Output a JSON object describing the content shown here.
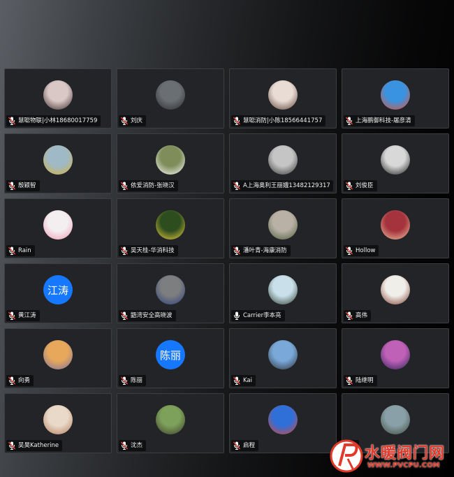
{
  "participants": [
    {
      "name": "慧聪物联|小林18680017759",
      "mic": "muted",
      "avatar": {
        "type": "photo",
        "colors": [
          "#d9c8c6",
          "#3a2a28"
        ]
      }
    },
    {
      "name": "刘庆",
      "mic": "muted",
      "avatar": {
        "type": "photo",
        "colors": [
          "#6a6f74",
          "#2c2c2c"
        ]
      }
    },
    {
      "name": "慧聪消防|小陈18566441757",
      "mic": "muted",
      "avatar": {
        "type": "photo",
        "colors": [
          "#e8dcd5",
          "#5a3e33"
        ]
      }
    },
    {
      "name": "上海鹏御科技-屠彦清",
      "mic": "muted",
      "avatar": {
        "type": "photo",
        "colors": [
          "#3a93e0",
          "#e45234"
        ]
      }
    },
    {
      "name": "殷颖智",
      "mic": "muted",
      "avatar": {
        "type": "photo",
        "colors": [
          "#9fb9c6",
          "#d6b23b"
        ]
      }
    },
    {
      "name": "依爱消防-张晓汉",
      "mic": "muted",
      "avatar": {
        "type": "photo",
        "colors": [
          "#7e8d5a",
          "#ffffff"
        ]
      }
    },
    {
      "name": "A上海奥利王丽娥13482129317",
      "mic": "muted",
      "avatar": {
        "type": "photo",
        "colors": [
          "#c5c5c5",
          "#333333"
        ]
      }
    },
    {
      "name": "刘俊臣",
      "mic": "muted",
      "avatar": {
        "type": "photo",
        "colors": [
          "#d8d8d8",
          "#1a1a1a"
        ]
      }
    },
    {
      "name": "Rain",
      "mic": "muted",
      "avatar": {
        "type": "photo",
        "colors": [
          "#f3eef0",
          "#f19ab2"
        ]
      }
    },
    {
      "name": "吴天桂-华消科技",
      "mic": "muted",
      "avatar": {
        "type": "photo",
        "colors": [
          "#2e4d1f",
          "#f2d23c"
        ]
      }
    },
    {
      "name": "潘叶青-海康消防",
      "mic": "muted",
      "avatar": {
        "type": "photo",
        "colors": [
          "#b9b1a6",
          "#4b5c3a"
        ]
      }
    },
    {
      "name": "Hollow",
      "mic": "muted",
      "avatar": {
        "type": "photo",
        "colors": [
          "#a5333d",
          "#f2c7a3"
        ]
      }
    },
    {
      "name": "黄江涛",
      "mic": "muted",
      "avatar": {
        "type": "text",
        "text": "江涛",
        "color": "#1677ff"
      }
    },
    {
      "name": "鼯湾安全高晓波",
      "mic": "muted",
      "avatar": {
        "type": "photo",
        "colors": [
          "#7d7e80",
          "#2b3e7a"
        ]
      }
    },
    {
      "name": "Carrier李本亮",
      "mic": "on",
      "avatar": {
        "type": "photo",
        "colors": [
          "#c9e0ea",
          "#2b3b2a"
        ]
      }
    },
    {
      "name": "高伟",
      "mic": "muted",
      "avatar": {
        "type": "photo",
        "colors": [
          "#f0eee9",
          "#7a3a2a"
        ]
      }
    },
    {
      "name": "向勇",
      "mic": "muted",
      "avatar": {
        "type": "photo",
        "colors": [
          "#e7a85b",
          "#7b6fa0"
        ]
      }
    },
    {
      "name": "陈丽",
      "mic": "muted",
      "avatar": {
        "type": "text",
        "text": "陈丽",
        "color": "#1677ff"
      }
    },
    {
      "name": "Kai",
      "mic": "muted",
      "avatar": {
        "type": "photo",
        "colors": [
          "#7aa8d8",
          "#2c3238"
        ]
      }
    },
    {
      "name": "陆继明",
      "mic": "muted",
      "avatar": {
        "type": "photo",
        "colors": [
          "#c061b8",
          "#2a2354"
        ]
      }
    },
    {
      "name": "吴昊Katherine",
      "mic": "muted",
      "avatar": {
        "type": "photo",
        "colors": [
          "#e9d9c8",
          "#b27a5a"
        ]
      }
    },
    {
      "name": "沈杰",
      "mic": "muted",
      "avatar": {
        "type": "photo",
        "colors": [
          "#7da05a",
          "#3a3a2a"
        ]
      }
    },
    {
      "name": "启程",
      "mic": "muted",
      "avatar": {
        "type": "photo",
        "colors": [
          "#2f6fd8",
          "#d9463a"
        ]
      }
    },
    {
      "name": "",
      "mic": "muted",
      "avatar": {
        "type": "photo",
        "colors": [
          "#8aa0a8",
          "#3a4a3a"
        ]
      }
    }
  ],
  "watermark": {
    "title": "水暖阀门网",
    "url": "WWW.PVCPU.COM",
    "color": "#e23a2a"
  },
  "colors": {
    "muted_mic": "#e0453c",
    "mic": "#ffffff",
    "tile_bg": "#232427",
    "tile_border": "#3c3e42"
  }
}
